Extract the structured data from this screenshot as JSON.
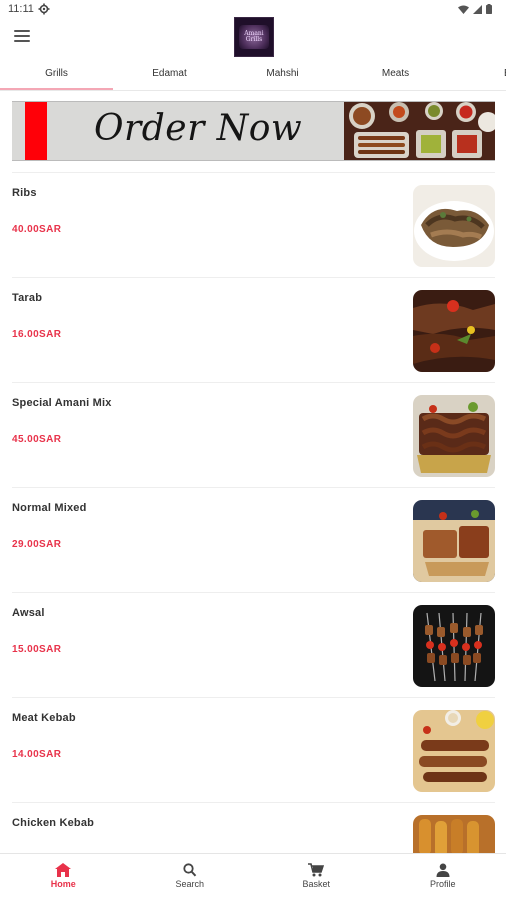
{
  "status_bar": {
    "time": "11:11",
    "icons": [
      "gear-icon",
      "wifi-icon",
      "signal-icon",
      "battery-icon"
    ]
  },
  "header": {
    "logo_text": "Amani Grills",
    "menu_icon": "hamburger-menu-icon"
  },
  "tabs": [
    {
      "label": "Grills",
      "active": true
    },
    {
      "label": "Edamat",
      "active": false
    },
    {
      "label": "Mahshi",
      "active": false
    },
    {
      "label": "Meats",
      "active": false
    },
    {
      "label": "Bi",
      "active": false
    }
  ],
  "banner": {
    "text": "Order Now"
  },
  "items": [
    {
      "name": "Ribs",
      "price": "40.00SAR"
    },
    {
      "name": "Tarab",
      "price": "16.00SAR"
    },
    {
      "name": "Special Amani Mix",
      "price": "45.00SAR"
    },
    {
      "name": "Normal Mixed",
      "price": "29.00SAR"
    },
    {
      "name": "Awsal",
      "price": "15.00SAR"
    },
    {
      "name": "Meat Kebab",
      "price": "14.00SAR"
    },
    {
      "name": "Chicken Kebab",
      "price": ""
    }
  ],
  "bottom_nav": [
    {
      "label": "Home",
      "icon": "home-icon",
      "active": true
    },
    {
      "label": "Search",
      "icon": "search-icon",
      "active": false
    },
    {
      "label": "Basket",
      "icon": "cart-icon",
      "active": false
    },
    {
      "label": "Profile",
      "icon": "person-icon",
      "active": false
    }
  ],
  "colors": {
    "accent": "#e8324a",
    "banner_red": "#ff0008",
    "tab_underline": "#f4a7b5"
  }
}
